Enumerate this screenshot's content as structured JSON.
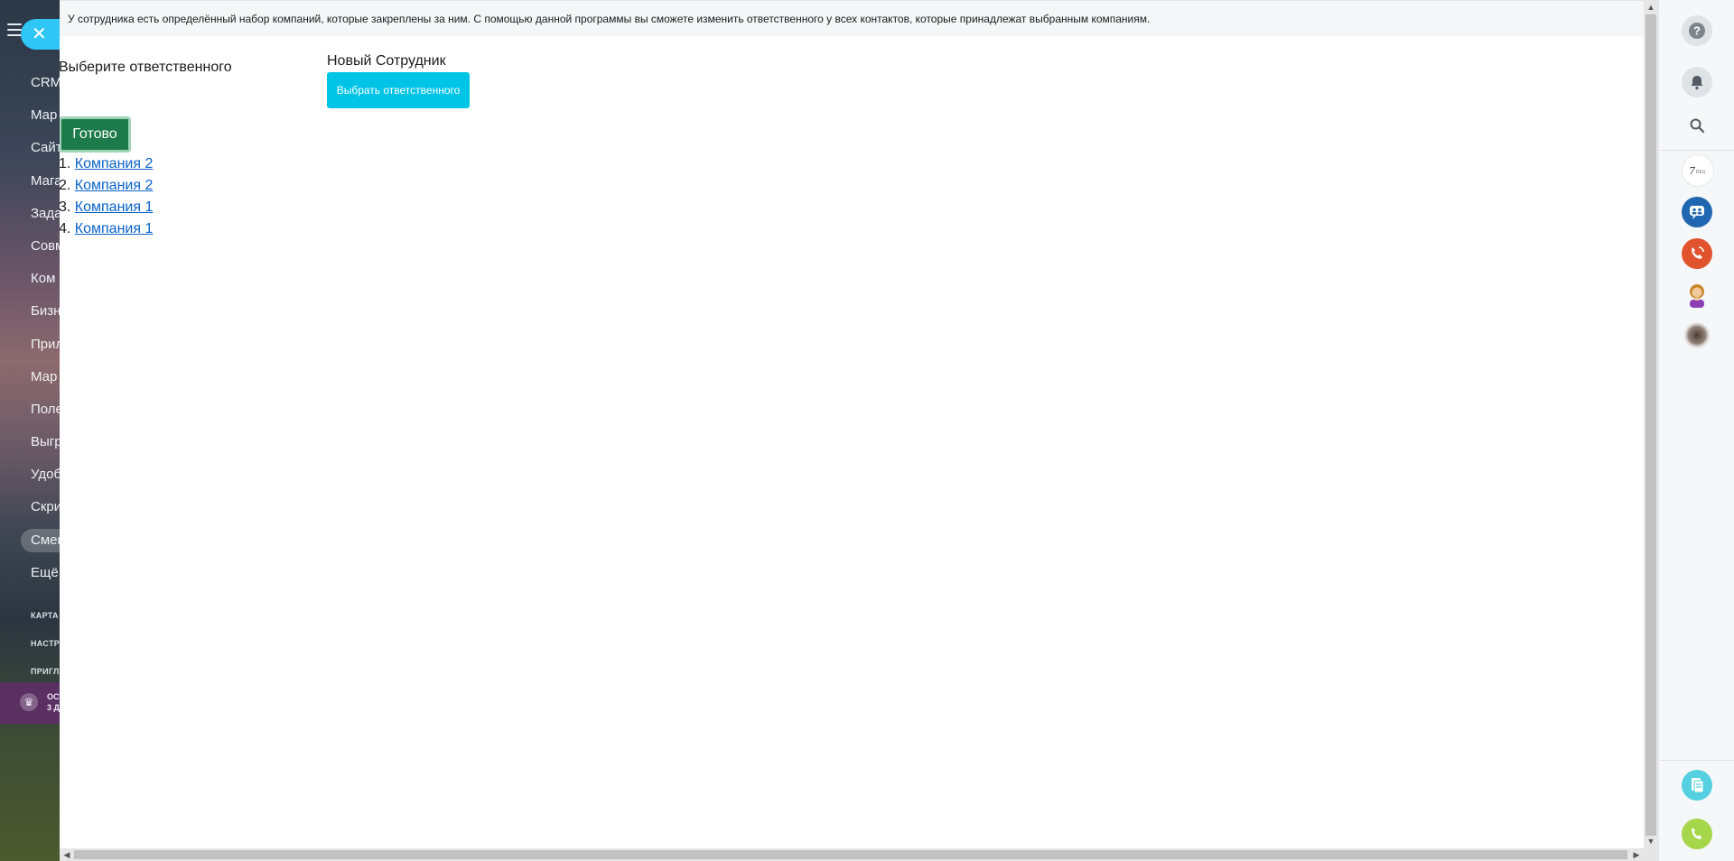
{
  "portal": {
    "nav_items": [
      "CRM",
      "Мар",
      "Сайт",
      "Мага",
      "Зада",
      "Совм",
      "Ком",
      "Бизн",
      "Прил",
      "Мар",
      "Поле",
      "Выгр",
      "Удоб",
      "Скри",
      "Смен",
      "Ещё"
    ],
    "active_index": 14,
    "small_items": [
      "КАРТА",
      "НАСТР",
      "ПРИГЛ"
    ],
    "promo_lines": [
      "ОСТ",
      "3 Д"
    ]
  },
  "slider": {
    "close_symbol": "✕",
    "info_text": "У сотрудника есть определённый набор компаний, которые закреплены за ним. С помощью данной программы вы сможете изменить ответственного у всех контактов, которые принадлежат выбранным компаниям.",
    "choose_label": "Выберите ответственного",
    "employee_name": "Новый Сотрудник",
    "choose_button": "Выбрать ответственного",
    "done_button": "Готово",
    "companies": [
      {
        "num": "1.",
        "name": "Компания 2"
      },
      {
        "num": "2.",
        "name": "Компания 2"
      },
      {
        "num": "3.",
        "name": "Компания 1"
      },
      {
        "num": "4.",
        "name": "Компания 1"
      }
    ]
  },
  "right_rail": {
    "icons": [
      "help-icon",
      "notifications-icon",
      "search-icon",
      "app-avatar",
      "group-chat-icon",
      "telephony-icon",
      "user-avatar",
      "user-avatar-blurred",
      "documents-icon",
      "phone-call-icon"
    ],
    "colors": {
      "group_chat": "#2066b0",
      "telephony": "#e0532c",
      "documents": "#55d0e0",
      "phone_call": "#a6d64a"
    }
  },
  "colors": {
    "accent": "#00c4e6",
    "done_button": "#1d7a4a",
    "link": "#0a63c9"
  }
}
